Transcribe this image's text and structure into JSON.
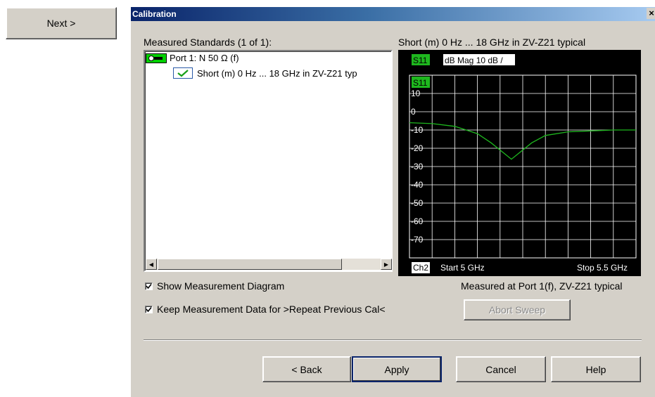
{
  "side": {
    "next_label": "Next >"
  },
  "dialog": {
    "title": "Calibration",
    "close_glyph": "×",
    "measured_label": "Measured Standards (1 of 1):",
    "tree": {
      "port": "Port 1: N 50 Ω (f)",
      "standard": "Short (m) 0 Hz  ... 18 GHz  in ZV-Z21 typ"
    },
    "diagram_title": "Short  (m) 0 Hz ... 18 GHz in ZV-Z21 typical",
    "show_diagram_label": "Show Measurement Diagram",
    "keep_data_label": "Keep Measurement Data for >Repeat Previous Cal<",
    "measured_at": "Measured at Port 1(f), ZV-Z21 typical",
    "abort_label": "Abort Sweep",
    "buttons": {
      "back": "< Back",
      "apply": "Apply",
      "cancel": "Cancel",
      "help": "Help"
    },
    "icons": [
      "port-connector-icon",
      "checkmark-icon",
      "scroll-left-icon",
      "scroll-right-icon",
      "close-icon"
    ]
  },
  "chart_data": {
    "type": "line",
    "trace_label": "S11",
    "format_label": "dB Mag 10 dB /",
    "channel_label": "Ch2",
    "start_label": "Start 5 GHz",
    "stop_label": "Stop 5.5 GHz",
    "x_range_ghz": [
      5.0,
      5.5
    ],
    "ylim": [
      -80,
      20
    ],
    "yticks": [
      "10",
      "0",
      "-10",
      "-20",
      "-30",
      "-40",
      "-50",
      "-60",
      "-70"
    ],
    "grid": true,
    "series": [
      {
        "name": "S11",
        "color": "#1eb71e",
        "x": [
          5.0,
          5.05,
          5.1,
          5.15,
          5.18,
          5.21,
          5.225,
          5.24,
          5.27,
          5.3,
          5.35,
          5.4,
          5.45,
          5.5
        ],
        "values": [
          -6,
          -6.5,
          -8,
          -12,
          -17,
          -23,
          -26,
          -23,
          -17,
          -13,
          -11,
          -10.5,
          -10,
          -10
        ]
      }
    ]
  }
}
